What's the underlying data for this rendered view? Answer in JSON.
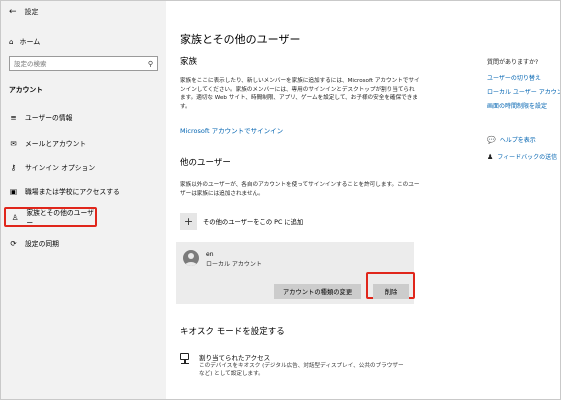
{
  "window": {
    "title": "設定"
  },
  "sidebar": {
    "home": "ホーム",
    "search_placeholder": "設定の検索",
    "section": "アカウント",
    "items": [
      {
        "label": "ユーザーの情報",
        "icon": "user-info-icon"
      },
      {
        "label": "メールとアカウント",
        "icon": "mail-icon"
      },
      {
        "label": "サインイン オプション",
        "icon": "key-icon"
      },
      {
        "label": "職場または学校にアクセスする",
        "icon": "briefcase-icon"
      },
      {
        "label": "家族とその他のユーザー",
        "icon": "person-icon"
      },
      {
        "label": "設定の同期",
        "icon": "sync-icon"
      }
    ]
  },
  "main": {
    "title": "家族とその他のユーザー",
    "family": {
      "heading": "家族",
      "description": "家族をここに表示したり、新しいメンバーを家族に追加するには、Microsoft アカウントでサインインしてください。家族のメンバーには、専用のサインインとデスクトップが割り当てられます。適切な Web サイト、時間制限、アプリ、ゲームを設定して、お子様の安全を確保できます。",
      "link": "Microsoft アカウントでサインイン"
    },
    "other_users": {
      "heading": "他のユーザー",
      "description": "家族以外のユーザーが、各自のアカウントを使ってサインインすることを許可します。このユーザーは家族には追加されません。",
      "add_label": "その他のユーザーをこの PC に追加",
      "user": {
        "name": "en",
        "type": "ローカル アカウント",
        "change_type_button": "アカウントの種類の変更",
        "delete_button": "削除"
      }
    },
    "kiosk": {
      "heading": "キオスク モードを設定する",
      "title": "割り当てられたアクセス",
      "description": "このデバイスをキオスク (デジタル広告、対話型ディスプレイ、公共のブラウザーなど) として設定します。"
    }
  },
  "right_panel": {
    "heading": "質問がありますか?",
    "links": [
      "ユーザーの切り替え",
      "ローカル ユーザー アカウントの",
      "画面の時間制限を設定"
    ],
    "help": "ヘルプを表示",
    "feedback": "フィードバックの送信"
  },
  "colors": {
    "accent": "#0063b1",
    "highlight": "#e0261b",
    "sidebar_bg": "#f2f2f2"
  }
}
